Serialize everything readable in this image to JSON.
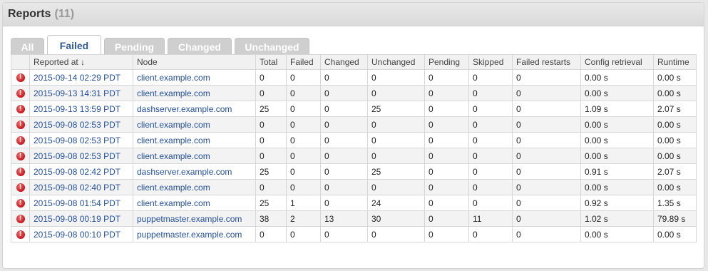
{
  "header": {
    "title": "Reports",
    "count": "(11)"
  },
  "tabs": [
    {
      "label": "All",
      "active": false
    },
    {
      "label": "Failed",
      "active": true
    },
    {
      "label": "Pending",
      "active": false
    },
    {
      "label": "Changed",
      "active": false
    },
    {
      "label": "Unchanged",
      "active": false
    }
  ],
  "columns": [
    "",
    "Reported at ↓",
    "Node",
    "Total",
    "Failed",
    "Changed",
    "Unchanged",
    "Pending",
    "Skipped",
    "Failed restarts",
    "Config retrieval",
    "Runtime"
  ],
  "status_icon": "error-icon",
  "rows": [
    [
      "2015-09-14 02:29 PDT",
      "client.example.com",
      "0",
      "0",
      "0",
      "0",
      "0",
      "0",
      "0",
      "0.00 s",
      "0.00 s"
    ],
    [
      "2015-09-13 14:31 PDT",
      "client.example.com",
      "0",
      "0",
      "0",
      "0",
      "0",
      "0",
      "0",
      "0.00 s",
      "0.00 s"
    ],
    [
      "2015-09-13 13:59 PDT",
      "dashserver.example.com",
      "25",
      "0",
      "0",
      "25",
      "0",
      "0",
      "0",
      "1.09 s",
      "2.07 s"
    ],
    [
      "2015-09-08 02:53 PDT",
      "client.example.com",
      "0",
      "0",
      "0",
      "0",
      "0",
      "0",
      "0",
      "0.00 s",
      "0.00 s"
    ],
    [
      "2015-09-08 02:53 PDT",
      "client.example.com",
      "0",
      "0",
      "0",
      "0",
      "0",
      "0",
      "0",
      "0.00 s",
      "0.00 s"
    ],
    [
      "2015-09-08 02:53 PDT",
      "client.example.com",
      "0",
      "0",
      "0",
      "0",
      "0",
      "0",
      "0",
      "0.00 s",
      "0.00 s"
    ],
    [
      "2015-09-08 02:42 PDT",
      "dashserver.example.com",
      "25",
      "0",
      "0",
      "25",
      "0",
      "0",
      "0",
      "0.91 s",
      "2.07 s"
    ],
    [
      "2015-09-08 02:40 PDT",
      "client.example.com",
      "0",
      "0",
      "0",
      "0",
      "0",
      "0",
      "0",
      "0.00 s",
      "0.00 s"
    ],
    [
      "2015-09-08 01:54 PDT",
      "client.example.com",
      "25",
      "1",
      "0",
      "24",
      "0",
      "0",
      "0",
      "0.92 s",
      "1.35 s"
    ],
    [
      "2015-09-08 00:19 PDT",
      "puppetmaster.example.com",
      "38",
      "2",
      "13",
      "30",
      "0",
      "11",
      "0",
      "1.02 s",
      "79.89 s"
    ],
    [
      "2015-09-08 00:10 PDT",
      "puppetmaster.example.com",
      "0",
      "0",
      "0",
      "0",
      "0",
      "0",
      "0",
      "0.00 s",
      "0.00 s"
    ]
  ]
}
